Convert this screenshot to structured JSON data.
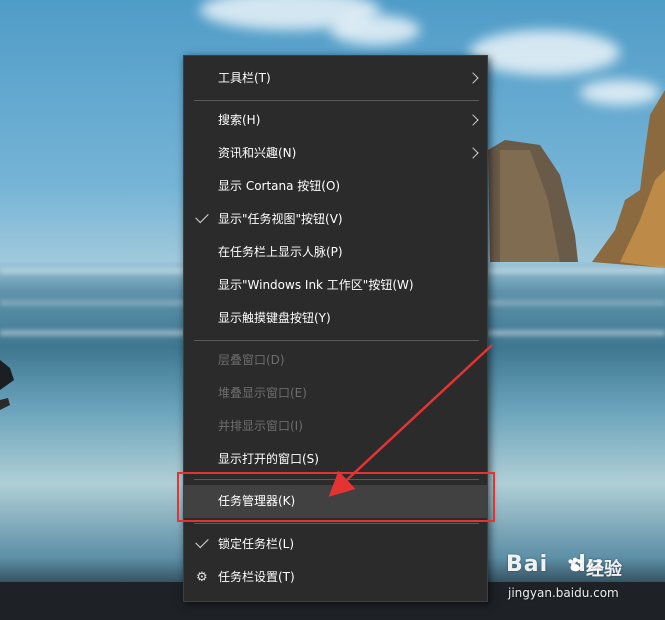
{
  "context_menu": {
    "items": [
      {
        "label": "工具栏(T)",
        "state": "normal",
        "submenu": true
      },
      {
        "label": "搜索(H)",
        "state": "normal",
        "submenu": true
      },
      {
        "label": "资讯和兴趣(N)",
        "state": "normal",
        "submenu": true
      },
      {
        "label": "显示 Cortana 按钮(O)",
        "state": "normal"
      },
      {
        "label": "显示\"任务视图\"按钮(V)",
        "state": "checked"
      },
      {
        "label": "在任务栏上显示人脉(P)",
        "state": "normal"
      },
      {
        "label": "显示\"Windows Ink 工作区\"按钮(W)",
        "state": "normal"
      },
      {
        "label": "显示触摸键盘按钮(Y)",
        "state": "normal"
      },
      {
        "label": "层叠窗口(D)",
        "state": "disabled"
      },
      {
        "label": "堆叠显示窗口(E)",
        "state": "disabled"
      },
      {
        "label": "并排显示窗口(I)",
        "state": "disabled"
      },
      {
        "label": "显示打开的窗口(S)",
        "state": "normal"
      },
      {
        "label": "任务管理器(K)",
        "state": "highlighted"
      },
      {
        "label": "锁定任务栏(L)",
        "state": "checked"
      },
      {
        "label": "任务栏设置(T)",
        "state": "normal",
        "icon": "gear-icon"
      }
    ]
  },
  "annotation": {
    "color": "#e53333",
    "target": "任务管理器(K)"
  },
  "watermark": {
    "brand": "Bai",
    "brand_suffix": "du",
    "cn": "经验",
    "url": "jingyan.baidu.com"
  },
  "colors": {
    "menu_bg": "#2b2b2b",
    "highlight_bg": "#414141",
    "disabled_text": "#6d6d6d"
  }
}
